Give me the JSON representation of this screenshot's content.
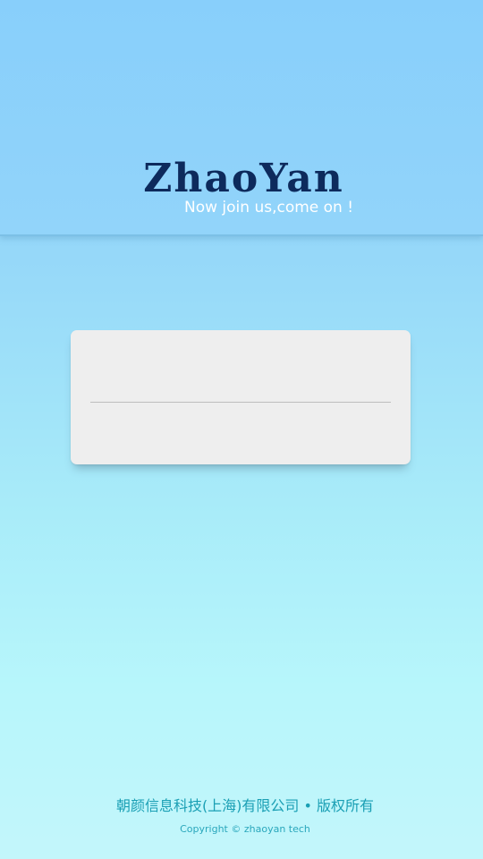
{
  "header": {
    "logo_text": "ZhaoYan",
    "tagline": "Now join us,come on !"
  },
  "login_form": {
    "username": {
      "value": "",
      "placeholder": ""
    },
    "password": {
      "value": "",
      "placeholder": ""
    }
  },
  "footer": {
    "company": "朝颜信息科技(上海)有限公司 • 版权所有",
    "copyright": "Copyright © zhaoyan tech"
  },
  "colors": {
    "logo": "#0d2a5c",
    "tagline": "#ffffff",
    "card_background": "#eeeeee",
    "footer_text": "#1a9fb4",
    "background_top": "#8bd0fb",
    "background_bottom": "#c3f6fb"
  }
}
